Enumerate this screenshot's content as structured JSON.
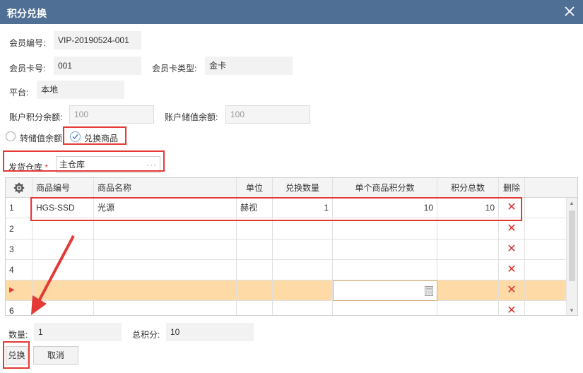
{
  "window": {
    "title": "积分兑换"
  },
  "form": {
    "member_no_label": "会员编号:",
    "member_no": "VIP-20190524-001",
    "card_no_label": "会员卡号:",
    "card_no": "001",
    "card_type_label": "会员卡类型:",
    "card_type": "金卡",
    "platform_label": "平台:",
    "platform": "本地",
    "points_balance_label": "账户积分余额:",
    "points_balance": "100",
    "stored_balance_label": "账户储值余额:",
    "stored_balance": "100",
    "option_stored_label": "转储值余额",
    "option_goods_label": "兑换商品",
    "warehouse_label": "发货仓库",
    "required_mark": "*",
    "warehouse": "主仓库",
    "warehouse_dots": "···"
  },
  "grid": {
    "headers": [
      "商品编号",
      "商品名称",
      "单位",
      "兑换数量",
      "单个商品积分数",
      "积分总数",
      "删除"
    ],
    "rows": [
      {
        "no": "1",
        "code": "HGS-SSD",
        "name": "光源",
        "unit": "赫视",
        "qty": "1",
        "unit_points": "10",
        "total_points": "10"
      },
      {
        "no": "2",
        "code": "",
        "name": "",
        "unit": "",
        "qty": "",
        "unit_points": "",
        "total_points": ""
      },
      {
        "no": "3",
        "code": "",
        "name": "",
        "unit": "",
        "qty": "",
        "unit_points": "",
        "total_points": ""
      },
      {
        "no": "4",
        "code": "",
        "name": "",
        "unit": "",
        "qty": "",
        "unit_points": "",
        "total_points": ""
      },
      {
        "no": "",
        "code": "",
        "name": "",
        "unit": "",
        "qty": "",
        "unit_points": "",
        "total_points": ""
      },
      {
        "no": "6",
        "code": "",
        "name": "",
        "unit": "",
        "qty": "",
        "unit_points": "",
        "total_points": ""
      }
    ],
    "delete_glyph": "✕",
    "current_row_marker": "▶"
  },
  "summary": {
    "qty_label": "数量:",
    "qty": "1",
    "total_points_label": "总积分:",
    "total_points": "10"
  },
  "buttons": {
    "exchange": "兑换",
    "cancel": "取消"
  },
  "colors": {
    "titlebar": "#4f6f94",
    "active_row": "#fddaa6",
    "highlight_box": "#e53935",
    "delete": "#d9302e"
  }
}
